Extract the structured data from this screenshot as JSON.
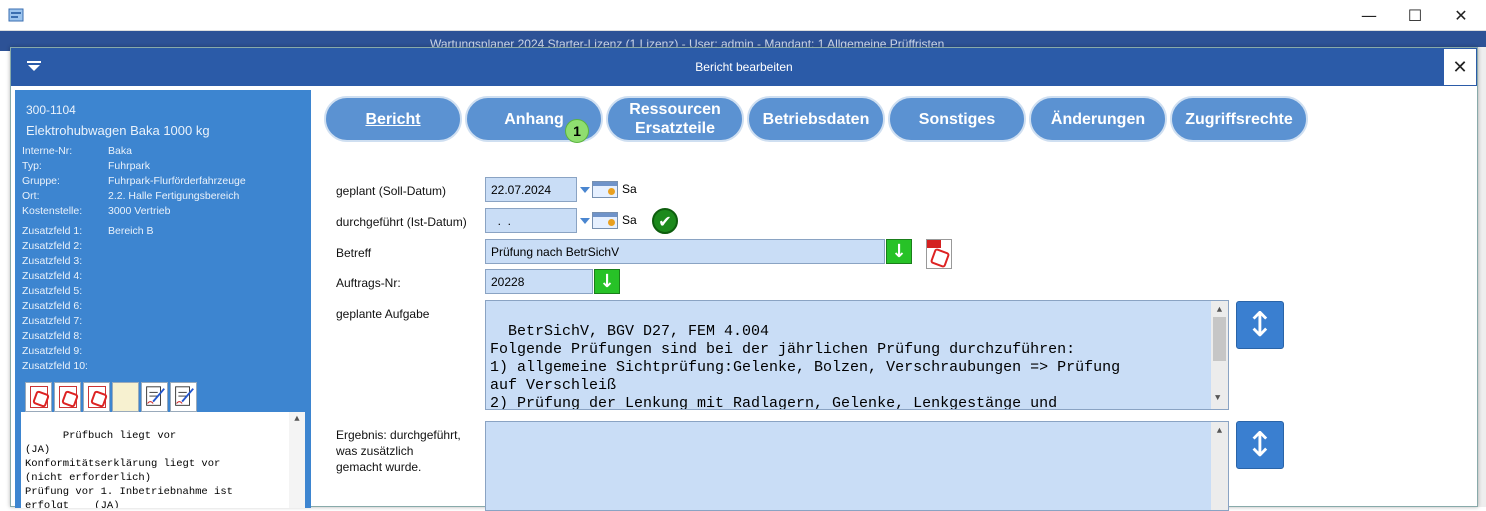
{
  "window": {
    "app_title": "Wartungsplaner 2024 Starter-Lizenz (1 Lizenz) - User: admin - Mandant: 1 Allgemeine Prüffristen"
  },
  "dialog": {
    "title": "Bericht bearbeiten"
  },
  "sidebar": {
    "id": "300-1104",
    "name": "Elektrohubwagen Baka 1000 kg",
    "fields": [
      {
        "key": "Interne-Nr:",
        "value": "Baka"
      },
      {
        "key": "Typ:",
        "value": "Fuhrpark"
      },
      {
        "key": "Gruppe:",
        "value": "Fuhrpark-Flurförderfahrzeuge"
      },
      {
        "key": "Ort:",
        "value": "2.2. Halle Fertigungsbereich"
      },
      {
        "key": "Kostenstelle:",
        "value": "3000 Vertrieb"
      }
    ],
    "zusatz": [
      {
        "key": "Zusatzfeld 1:",
        "value": "Bereich B"
      },
      {
        "key": "Zusatzfeld 2:",
        "value": ""
      },
      {
        "key": "Zusatzfeld 3:",
        "value": ""
      },
      {
        "key": "Zusatzfeld 4:",
        "value": ""
      },
      {
        "key": "Zusatzfeld 5:",
        "value": ""
      },
      {
        "key": "Zusatzfeld 6:",
        "value": ""
      },
      {
        "key": "Zusatzfeld 7:",
        "value": ""
      },
      {
        "key": "Zusatzfeld 8:",
        "value": ""
      },
      {
        "key": "Zusatzfeld 9:",
        "value": ""
      },
      {
        "key": "Zusatzfeld 10:",
        "value": ""
      }
    ],
    "notes": "Prüfbuch liegt vor\n(JA)\nKonformitätserklärung liegt vor\n(nicht erforderlich)\nPrüfung vor 1. Inbetriebnahme ist\nerfolgt    (JA)"
  },
  "tabs": [
    {
      "label": "Bericht",
      "active": true
    },
    {
      "label": "Anhang",
      "active": false
    },
    {
      "label": "Ressourcen\nErsatzteile",
      "active": false
    },
    {
      "label": "Betriebsdaten",
      "active": false
    },
    {
      "label": "Sonstiges",
      "active": false
    },
    {
      "label": "Änderungen",
      "active": false
    },
    {
      "label": "Zugriffsrechte",
      "active": false
    }
  ],
  "anhang_badge": "1",
  "form": {
    "geplant_label": "geplant (Soll-Datum)",
    "geplant_value": "22.07.2024",
    "geplant_weekday": "Sa",
    "durchgefuehrt_label": "durchgeführt (Ist-Datum)",
    "durchgefuehrt_value": "  .  .",
    "durchgefuehrt_weekday": "Sa",
    "betreff_label": "Betreff",
    "betreff_value": "Prüfung nach BetrSichV",
    "auftrag_label": "Auftrags-Nr:",
    "auftrag_value": "20228",
    "aufgabe_label": "geplante Aufgabe",
    "aufgabe_value": "BetrSichV, BGV D27, FEM 4.004\nFolgende Prüfungen sind bei der jährlichen Prüfung durchzuführen:\n1) allgemeine Sichtprüfung:Gelenke, Bolzen, Verschraubungen => Prüfung\nauf Verschleiß\n2) Prüfung der Lenkung mit Radlagern, Gelenke, Lenkgestänge und\nDeichselsicherung",
    "ergebnis_label": "Ergebnis: durchgeführt,\nwas zusätzlich\ngemacht wurde.",
    "ergebnis_value": ""
  },
  "icons": {
    "close": "close-icon",
    "menu": "menu-icon",
    "calendar": "calendar-icon",
    "check": "check-icon",
    "arrow_down": "arrow-down-icon",
    "expand": "expand-vertical-icon",
    "pdf": "pdf-icon"
  },
  "colors": {
    "dialog_title": "#2b5ba8",
    "sidebar": "#3d85d0",
    "tab": "#5b92d2",
    "field": "#c9ddf6",
    "green_button": "#27c227"
  }
}
